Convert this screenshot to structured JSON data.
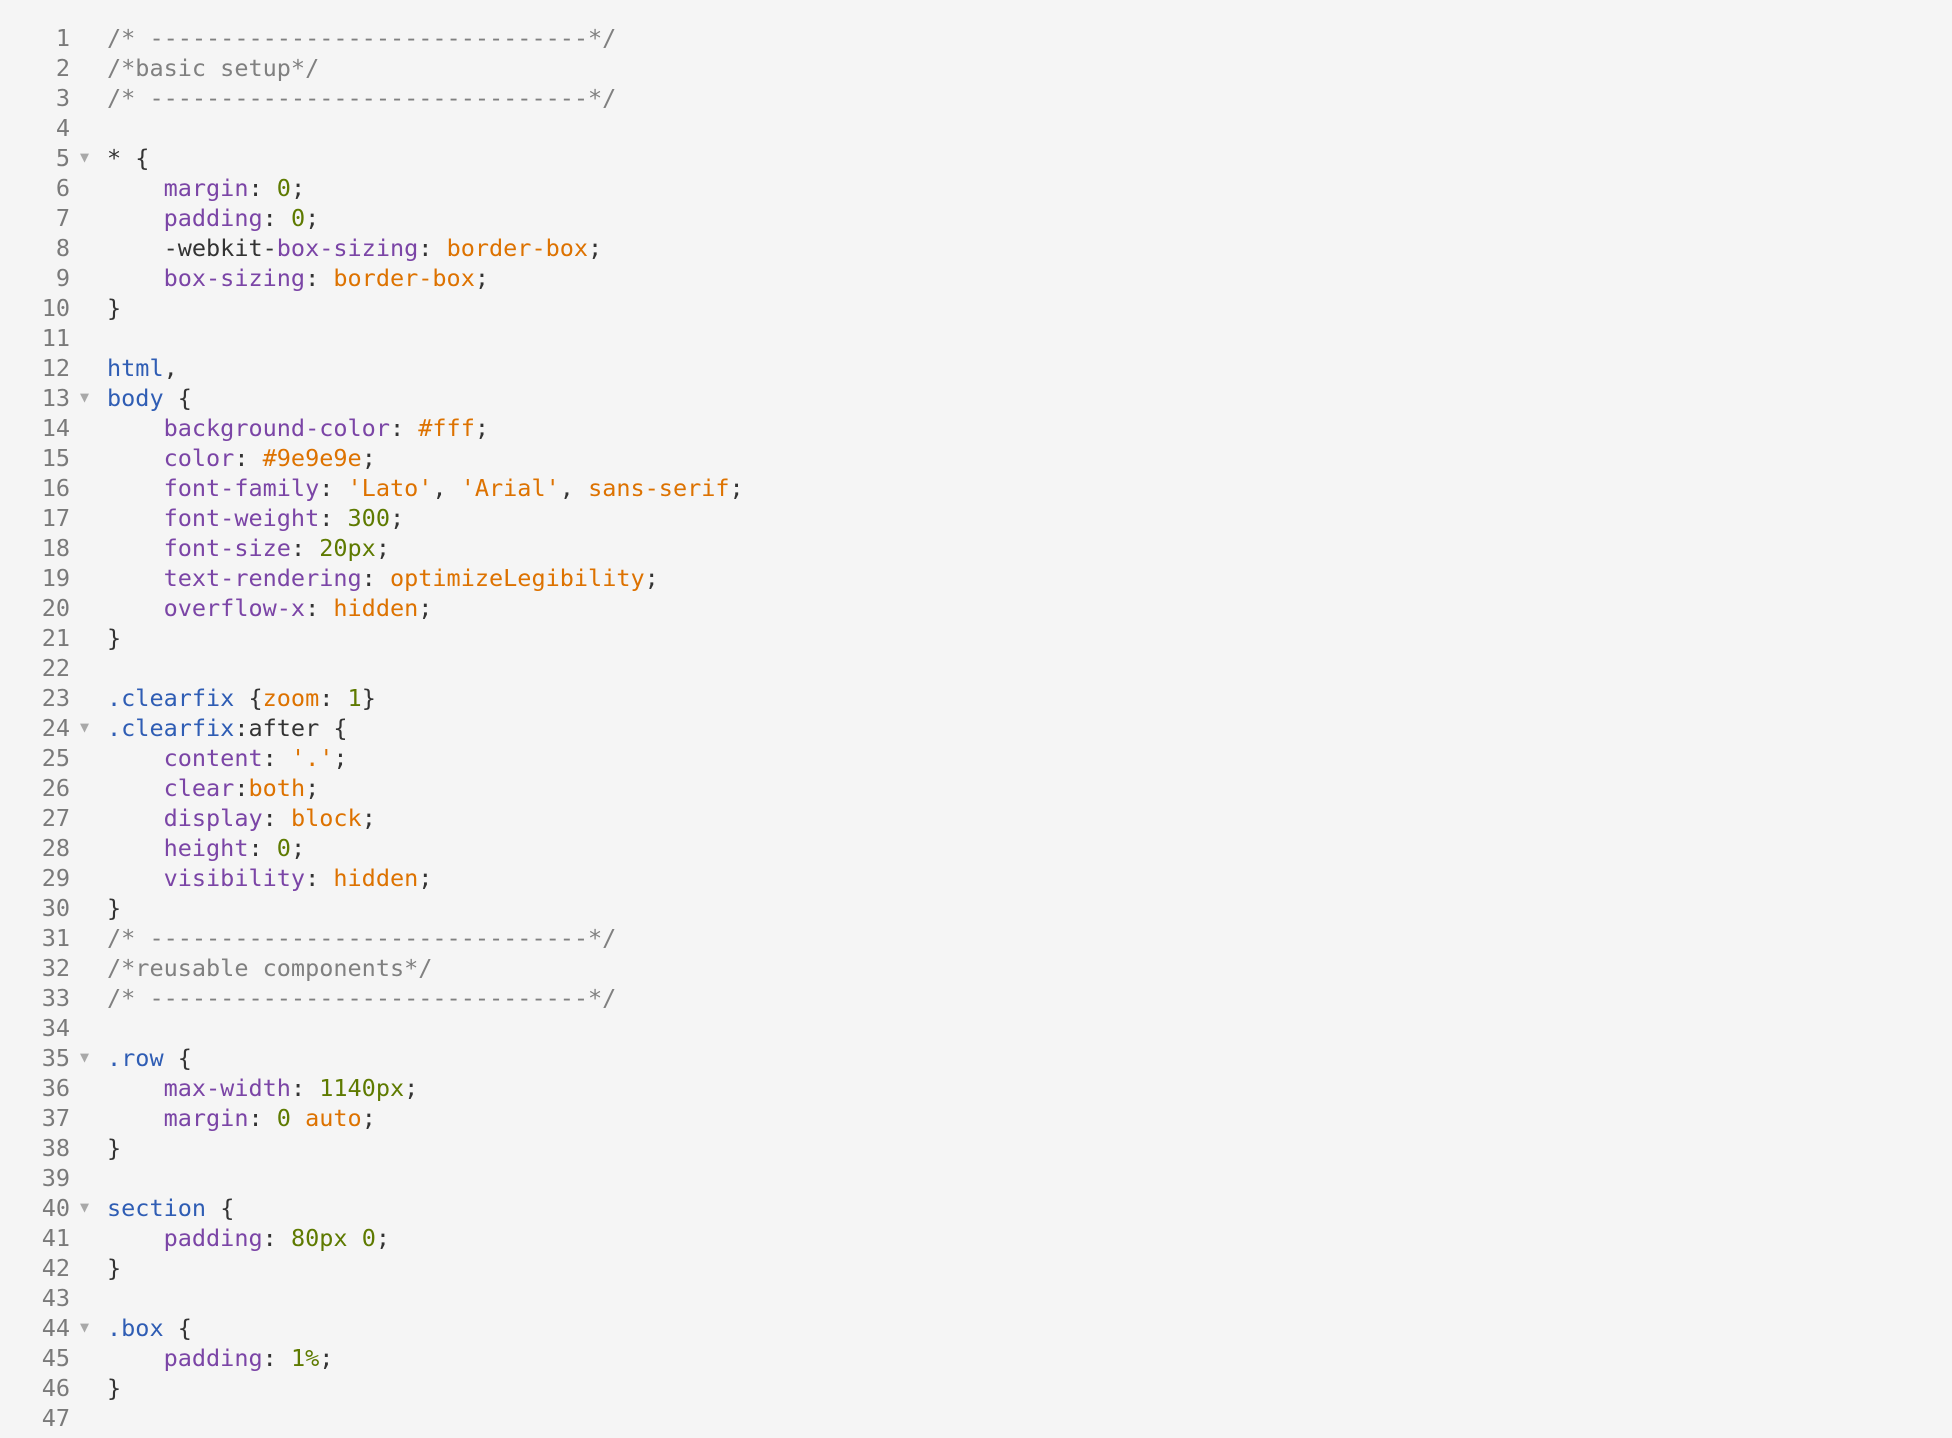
{
  "editor": {
    "language": "css",
    "fold_icon": "triangle-down-icon",
    "colors": {
      "background": "#f5f5f5",
      "line_number": "#7a7a7a",
      "comment": "#808080",
      "selector": "#2f5db4",
      "property": "#7b45a6",
      "string_value": "#dd7200",
      "number_value": "#5e7a00",
      "punctuation": "#333333"
    },
    "lines": [
      {
        "n": "1",
        "fold": false,
        "tokens": [
          [
            "c",
            "/* -------------------------------*/"
          ]
        ]
      },
      {
        "n": "2",
        "fold": false,
        "tokens": [
          [
            "c",
            "/*basic setup*/"
          ]
        ]
      },
      {
        "n": "3",
        "fold": false,
        "tokens": [
          [
            "c",
            "/* -------------------------------*/"
          ]
        ]
      },
      {
        "n": "4",
        "fold": false,
        "tokens": []
      },
      {
        "n": "5",
        "fold": true,
        "tokens": [
          [
            "p",
            "* {"
          ]
        ]
      },
      {
        "n": "6",
        "fold": false,
        "tokens": [
          [
            "p",
            "    "
          ],
          [
            "k",
            "margin"
          ],
          [
            "p",
            ": "
          ],
          [
            "n",
            "0"
          ],
          [
            "p",
            ";"
          ]
        ]
      },
      {
        "n": "7",
        "fold": false,
        "tokens": [
          [
            "p",
            "    "
          ],
          [
            "k",
            "padding"
          ],
          [
            "p",
            ": "
          ],
          [
            "n",
            "0"
          ],
          [
            "p",
            ";"
          ]
        ]
      },
      {
        "n": "8",
        "fold": false,
        "tokens": [
          [
            "p",
            "    -webkit-"
          ],
          [
            "k",
            "box-sizing"
          ],
          [
            "p",
            ": "
          ],
          [
            "s",
            "border-box"
          ],
          [
            "p",
            ";"
          ]
        ]
      },
      {
        "n": "9",
        "fold": false,
        "tokens": [
          [
            "p",
            "    "
          ],
          [
            "k",
            "box-sizing"
          ],
          [
            "p",
            ": "
          ],
          [
            "s",
            "border-box"
          ],
          [
            "p",
            ";"
          ]
        ]
      },
      {
        "n": "10",
        "fold": false,
        "tokens": [
          [
            "p",
            "}"
          ]
        ]
      },
      {
        "n": "11",
        "fold": false,
        "tokens": []
      },
      {
        "n": "12",
        "fold": false,
        "tokens": [
          [
            "b",
            "html"
          ],
          [
            "p",
            ","
          ]
        ]
      },
      {
        "n": "13",
        "fold": true,
        "tokens": [
          [
            "b",
            "body"
          ],
          [
            "p",
            " {"
          ]
        ]
      },
      {
        "n": "14",
        "fold": false,
        "tokens": [
          [
            "p",
            "    "
          ],
          [
            "k",
            "background-color"
          ],
          [
            "p",
            ": "
          ],
          [
            "s",
            "#fff"
          ],
          [
            "p",
            ";"
          ]
        ]
      },
      {
        "n": "15",
        "fold": false,
        "tokens": [
          [
            "p",
            "    "
          ],
          [
            "k",
            "color"
          ],
          [
            "p",
            ": "
          ],
          [
            "s",
            "#9e9e9e"
          ],
          [
            "p",
            ";"
          ]
        ]
      },
      {
        "n": "16",
        "fold": false,
        "tokens": [
          [
            "p",
            "    "
          ],
          [
            "k",
            "font-family"
          ],
          [
            "p",
            ": "
          ],
          [
            "s",
            "'Lato'"
          ],
          [
            "p",
            ", "
          ],
          [
            "s",
            "'Arial'"
          ],
          [
            "p",
            ", "
          ],
          [
            "s",
            "sans-serif"
          ],
          [
            "p",
            ";"
          ]
        ]
      },
      {
        "n": "17",
        "fold": false,
        "tokens": [
          [
            "p",
            "    "
          ],
          [
            "k",
            "font-weight"
          ],
          [
            "p",
            ": "
          ],
          [
            "n",
            "300"
          ],
          [
            "p",
            ";"
          ]
        ]
      },
      {
        "n": "18",
        "fold": false,
        "tokens": [
          [
            "p",
            "    "
          ],
          [
            "k",
            "font-size"
          ],
          [
            "p",
            ": "
          ],
          [
            "n",
            "20px"
          ],
          [
            "p",
            ";"
          ]
        ]
      },
      {
        "n": "19",
        "fold": false,
        "tokens": [
          [
            "p",
            "    "
          ],
          [
            "k",
            "text-rendering"
          ],
          [
            "p",
            ": "
          ],
          [
            "s",
            "optimizeLegibility"
          ],
          [
            "p",
            ";"
          ]
        ]
      },
      {
        "n": "20",
        "fold": false,
        "tokens": [
          [
            "p",
            "    "
          ],
          [
            "k",
            "overflow-x"
          ],
          [
            "p",
            ": "
          ],
          [
            "s",
            "hidden"
          ],
          [
            "p",
            ";"
          ]
        ]
      },
      {
        "n": "21",
        "fold": false,
        "tokens": [
          [
            "p",
            "}"
          ]
        ]
      },
      {
        "n": "22",
        "fold": false,
        "tokens": []
      },
      {
        "n": "23",
        "fold": false,
        "tokens": [
          [
            "b",
            ".clearfix"
          ],
          [
            "p",
            " {"
          ],
          [
            "s",
            "zoom"
          ],
          [
            "p",
            ": "
          ],
          [
            "n",
            "1"
          ],
          [
            "p",
            "}"
          ]
        ]
      },
      {
        "n": "24",
        "fold": true,
        "tokens": [
          [
            "b",
            ".clearfix"
          ],
          [
            "p",
            ":after {"
          ]
        ]
      },
      {
        "n": "25",
        "fold": false,
        "tokens": [
          [
            "p",
            "    "
          ],
          [
            "k",
            "content"
          ],
          [
            "p",
            ": "
          ],
          [
            "s",
            "'.'"
          ],
          [
            "p",
            ";"
          ]
        ]
      },
      {
        "n": "26",
        "fold": false,
        "tokens": [
          [
            "p",
            "    "
          ],
          [
            "k",
            "clear"
          ],
          [
            "p",
            ":"
          ],
          [
            "s",
            "both"
          ],
          [
            "p",
            ";"
          ]
        ]
      },
      {
        "n": "27",
        "fold": false,
        "tokens": [
          [
            "p",
            "    "
          ],
          [
            "k",
            "display"
          ],
          [
            "p",
            ": "
          ],
          [
            "s",
            "block"
          ],
          [
            "p",
            ";"
          ]
        ]
      },
      {
        "n": "28",
        "fold": false,
        "tokens": [
          [
            "p",
            "    "
          ],
          [
            "k",
            "height"
          ],
          [
            "p",
            ": "
          ],
          [
            "n",
            "0"
          ],
          [
            "p",
            ";"
          ]
        ]
      },
      {
        "n": "29",
        "fold": false,
        "tokens": [
          [
            "p",
            "    "
          ],
          [
            "k",
            "visibility"
          ],
          [
            "p",
            ": "
          ],
          [
            "s",
            "hidden"
          ],
          [
            "p",
            ";"
          ]
        ]
      },
      {
        "n": "30",
        "fold": false,
        "tokens": [
          [
            "p",
            "}"
          ]
        ]
      },
      {
        "n": "31",
        "fold": false,
        "tokens": [
          [
            "c",
            "/* -------------------------------*/"
          ]
        ]
      },
      {
        "n": "32",
        "fold": false,
        "tokens": [
          [
            "c",
            "/*reusable components*/"
          ]
        ]
      },
      {
        "n": "33",
        "fold": false,
        "tokens": [
          [
            "c",
            "/* -------------------------------*/"
          ]
        ]
      },
      {
        "n": "34",
        "fold": false,
        "tokens": []
      },
      {
        "n": "35",
        "fold": true,
        "tokens": [
          [
            "b",
            ".row"
          ],
          [
            "p",
            " {"
          ]
        ]
      },
      {
        "n": "36",
        "fold": false,
        "tokens": [
          [
            "p",
            "    "
          ],
          [
            "k",
            "max-width"
          ],
          [
            "p",
            ": "
          ],
          [
            "n",
            "1140px"
          ],
          [
            "p",
            ";"
          ]
        ]
      },
      {
        "n": "37",
        "fold": false,
        "tokens": [
          [
            "p",
            "    "
          ],
          [
            "k",
            "margin"
          ],
          [
            "p",
            ": "
          ],
          [
            "n",
            "0"
          ],
          [
            "p",
            " "
          ],
          [
            "s",
            "auto"
          ],
          [
            "p",
            ";"
          ]
        ]
      },
      {
        "n": "38",
        "fold": false,
        "tokens": [
          [
            "p",
            "}"
          ]
        ]
      },
      {
        "n": "39",
        "fold": false,
        "tokens": []
      },
      {
        "n": "40",
        "fold": true,
        "tokens": [
          [
            "b",
            "section"
          ],
          [
            "p",
            " {"
          ]
        ]
      },
      {
        "n": "41",
        "fold": false,
        "tokens": [
          [
            "p",
            "    "
          ],
          [
            "k",
            "padding"
          ],
          [
            "p",
            ": "
          ],
          [
            "n",
            "80px"
          ],
          [
            "p",
            " "
          ],
          [
            "n",
            "0"
          ],
          [
            "p",
            ";"
          ]
        ]
      },
      {
        "n": "42",
        "fold": false,
        "tokens": [
          [
            "p",
            "}"
          ]
        ]
      },
      {
        "n": "43",
        "fold": false,
        "tokens": []
      },
      {
        "n": "44",
        "fold": true,
        "tokens": [
          [
            "b",
            ".box"
          ],
          [
            "p",
            " {"
          ]
        ]
      },
      {
        "n": "45",
        "fold": false,
        "tokens": [
          [
            "p",
            "    "
          ],
          [
            "k",
            "padding"
          ],
          [
            "p",
            ": "
          ],
          [
            "n",
            "1%"
          ],
          [
            "p",
            ";"
          ]
        ]
      },
      {
        "n": "46",
        "fold": false,
        "tokens": [
          [
            "p",
            "}"
          ]
        ]
      },
      {
        "n": "47",
        "fold": false,
        "tokens": []
      }
    ]
  }
}
